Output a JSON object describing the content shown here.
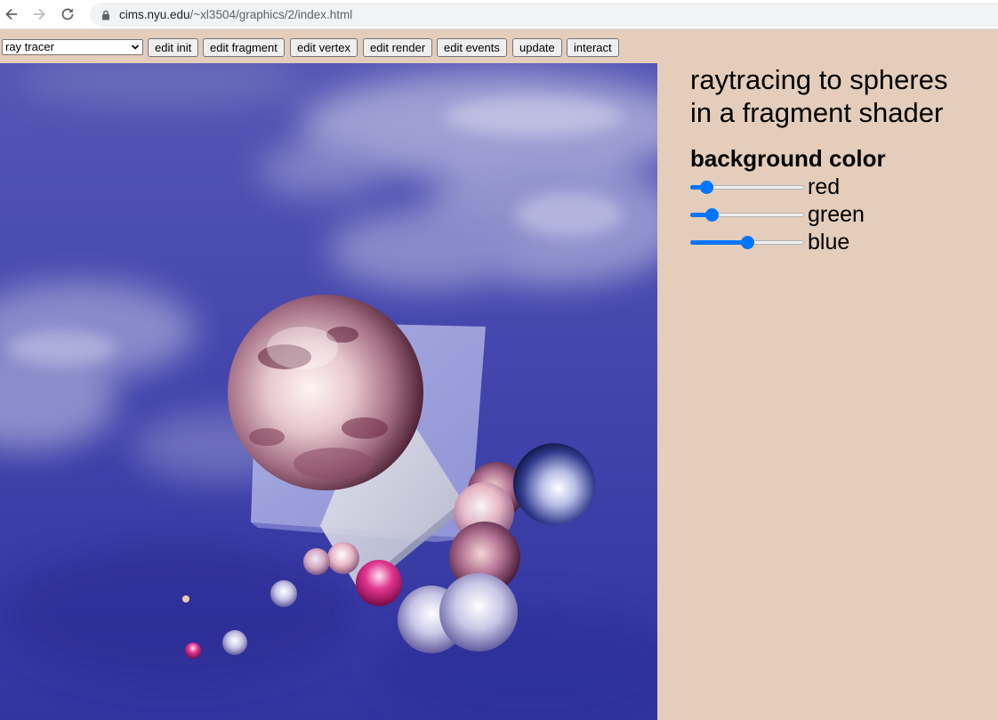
{
  "browser": {
    "url_host": "cims.nyu.edu",
    "url_path": "/~xl3504/graphics/2/index.html",
    "icons": [
      "back-arrow-icon",
      "forward-arrow-icon",
      "reload-icon",
      "lock-icon"
    ]
  },
  "toolbar": {
    "select_value": "ray tracer",
    "buttons": [
      "edit init",
      "edit fragment",
      "edit vertex",
      "edit render",
      "edit events",
      "update",
      "interact"
    ]
  },
  "panel": {
    "title_line1": "raytracing to spheres",
    "title_line2": "in a fragment shader",
    "section": "background color",
    "sliders": [
      {
        "label": "red",
        "value": 0.1
      },
      {
        "label": "green",
        "value": 0.15
      },
      {
        "label": "blue",
        "value": 0.5
      }
    ]
  },
  "colors": {
    "page_background": "#e4cdbb",
    "slider_accent": "#0075ff",
    "sky_blue": "#3f41a8",
    "cloud": "#b4b6dc"
  }
}
